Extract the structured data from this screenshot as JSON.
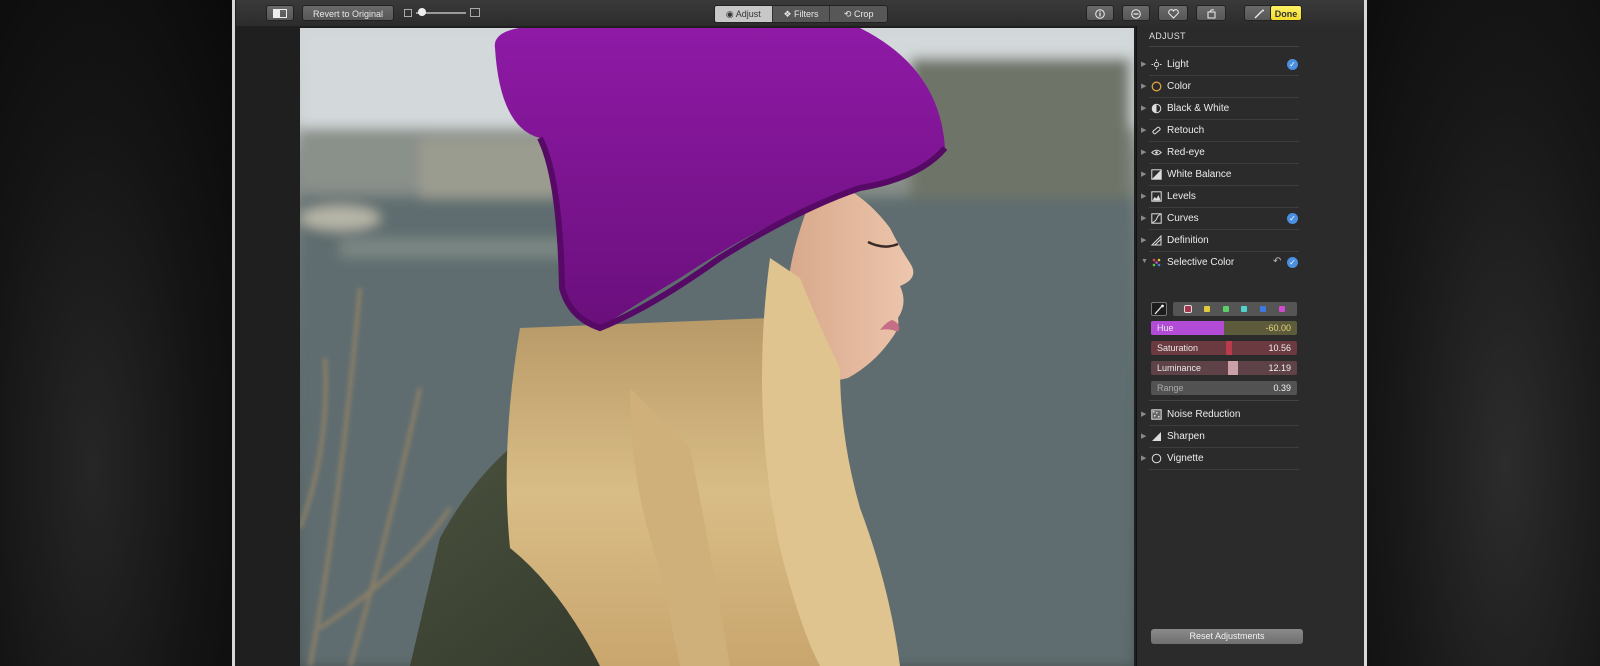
{
  "toolbar": {
    "revert_label": "Revert to Original",
    "tabs": [
      {
        "label": "Adjust",
        "active": true
      },
      {
        "label": "Filters",
        "active": false
      },
      {
        "label": "Crop",
        "active": false
      }
    ],
    "done_label": "Done"
  },
  "panel": {
    "title": "ADJUST",
    "items": [
      {
        "label": "Light",
        "icon": "sun-icon",
        "checked": true
      },
      {
        "label": "Color",
        "icon": "color-circle-icon",
        "checked": false
      },
      {
        "label": "Black & White",
        "icon": "half-circle-icon",
        "checked": false
      },
      {
        "label": "Retouch",
        "icon": "bandage-icon",
        "checked": false
      },
      {
        "label": "Red-eye",
        "icon": "eye-icon",
        "checked": false
      },
      {
        "label": "White Balance",
        "icon": "white-balance-icon",
        "checked": false
      },
      {
        "label": "Levels",
        "icon": "levels-icon",
        "checked": false
      },
      {
        "label": "Curves",
        "icon": "curves-icon",
        "checked": true
      },
      {
        "label": "Definition",
        "icon": "triangle-icon",
        "checked": false
      },
      {
        "label": "Selective Color",
        "icon": "selective-color-icon",
        "checked": true,
        "expanded": true
      }
    ],
    "selective_color": {
      "swatches": [
        "#a6344c",
        "#e0c93a",
        "#5ad06a",
        "#4fd5d0",
        "#3a7ae0",
        "#d04ad0"
      ],
      "sliders": [
        {
          "label": "Hue",
          "value": "-60.00",
          "level": 0.5,
          "color": "#b24cd6"
        },
        {
          "label": "Saturation",
          "value": "10.56",
          "level": 0.53,
          "color": "#9c3d4c"
        },
        {
          "label": "Luminance",
          "value": "12.19",
          "level": 0.55,
          "color": "#8c4a56"
        },
        {
          "label": "Range",
          "value": "0.39",
          "level": 0,
          "color": "#555555"
        }
      ]
    },
    "items_after": [
      {
        "label": "Noise Reduction",
        "icon": "noise-icon"
      },
      {
        "label": "Sharpen",
        "icon": "sharpen-icon"
      },
      {
        "label": "Vignette",
        "icon": "vignette-icon"
      }
    ],
    "reset_label": "Reset Adjustments"
  },
  "colors": {
    "accent_check": "#4a8fe0",
    "done_yellow": "#f2dc2c",
    "hat_purple": "#7d1392"
  }
}
